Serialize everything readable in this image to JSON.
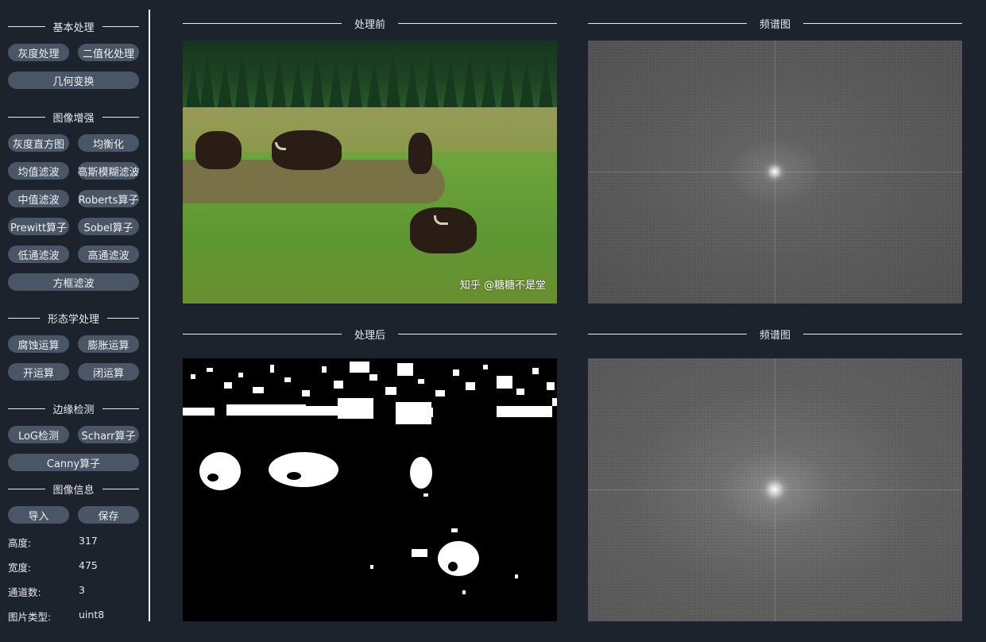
{
  "sidebar": {
    "sections": {
      "basic": "基本处理",
      "enhance": "图像增强",
      "morph": "形态学处理",
      "edge": "边缘检测",
      "info": "图像信息"
    },
    "buttons": {
      "grayscale": "灰度处理",
      "binarize": "二值化处理",
      "geometry": "几何变换",
      "gray_hist": "灰度直方图",
      "equalize": "均衡化",
      "mean_filter": "均值滤波",
      "gaussian_blur": "高斯模糊滤波",
      "median_filter": "中值滤波",
      "roberts": "Roberts算子",
      "prewitt": "Prewitt算子",
      "sobel": "Sobel算子",
      "lowpass": "低通滤波",
      "highpass": "高通滤波",
      "box_filter": "方框滤波",
      "erode": "腐蚀运算",
      "dilate": "膨胀运算",
      "open": "开运算",
      "close": "闭运算",
      "log": "LoG检测",
      "scharr": "Scharr算子",
      "canny": "Canny算子",
      "import": "导入",
      "save": "保存"
    },
    "info": {
      "height_label": "高度:",
      "height_value": "317",
      "width_label": "宽度:",
      "width_value": "475",
      "channels_label": "通道数:",
      "channels_value": "3",
      "type_label": "图片类型:",
      "type_value": "uint8"
    }
  },
  "panels": {
    "before_title": "处理前",
    "spectrum_before_title": "频谱图",
    "after_title": "处理后",
    "spectrum_after_title": "频谱图",
    "watermark": "知乎 @糖糖不是堂"
  },
  "colors": {
    "background": "#1d232d",
    "button": "#4a5565",
    "text": "#e8ebef"
  }
}
